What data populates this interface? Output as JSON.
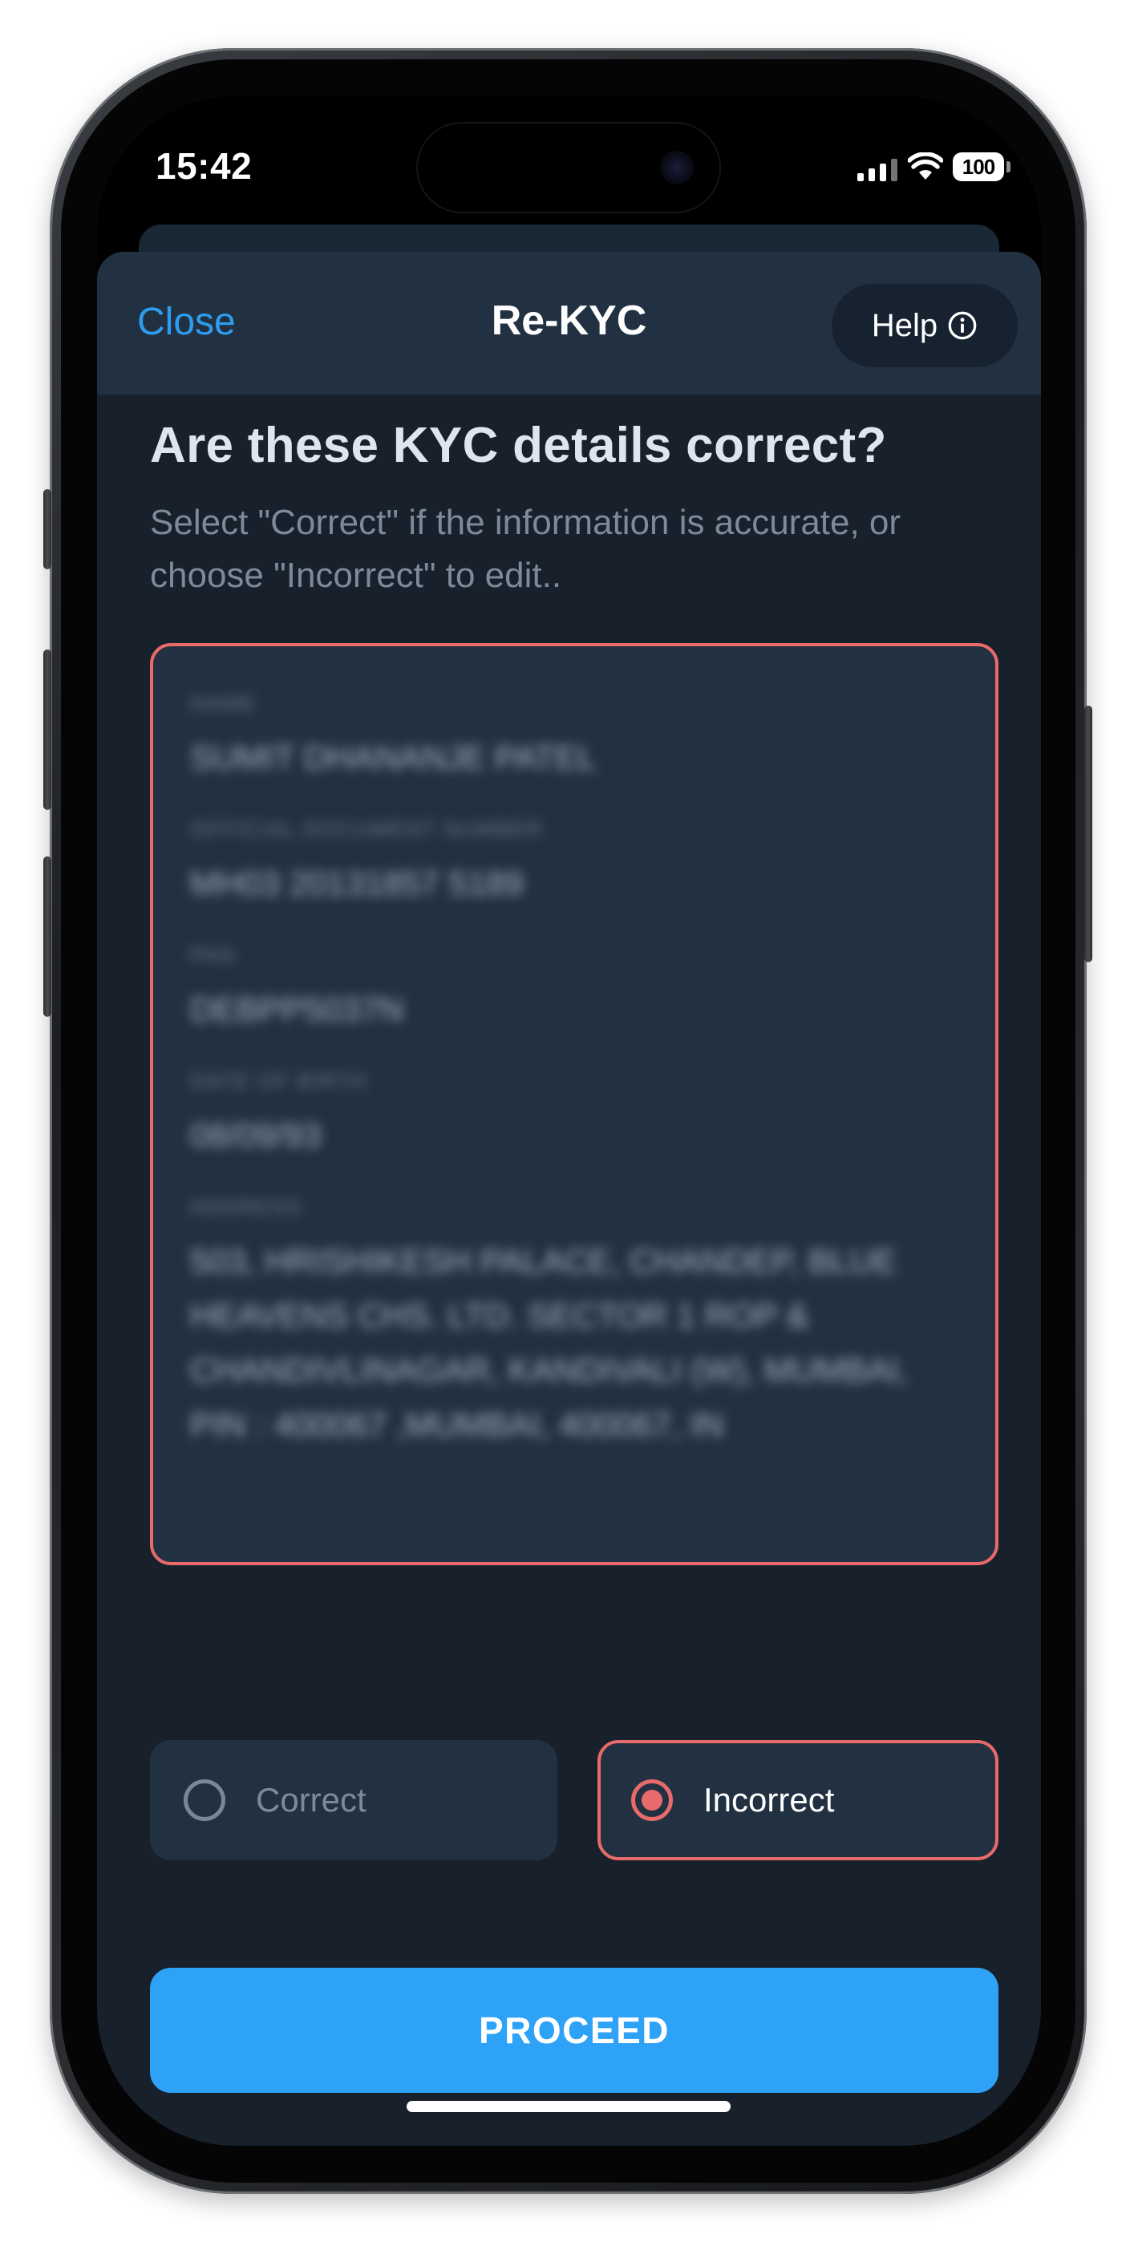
{
  "status_bar": {
    "time": "15:42",
    "battery": "100",
    "signal_bars": 4,
    "wifi_icon": "wifi-icon"
  },
  "header": {
    "close_label": "Close",
    "title": "Re-KYC",
    "help_label": "Help",
    "help_icon": "info-icon"
  },
  "content": {
    "title": "Are these KYC details correct?",
    "subtitle": "Select \"Correct\" if the information is accurate, or choose \"Incorrect\" to edit.."
  },
  "kyc_fields": [
    {
      "label": "Name",
      "value": "SUMIT DHANANJE PATEL"
    },
    {
      "label": "Official Document Number",
      "value": "MH03 20131857 5189"
    },
    {
      "label": "PAN",
      "value": "DEBPP5037N"
    },
    {
      "label": "Date of Birth",
      "value": "08/09/93"
    },
    {
      "label": "Address",
      "value": "503, HRISHIKESH PALACE, CHANDEP, BLUE HEAVENS CHS. LTD. SECTOR 1 ROP & CHANDIVLINAGAR, KANDIVALI (W), MUMBAI, PIN : 400067 ,MUMBAI, 400067, IN"
    }
  ],
  "options": {
    "correct_label": "Correct",
    "incorrect_label": "Incorrect",
    "selected": "Incorrect"
  },
  "proceed_label": "PROCEED",
  "colors": {
    "accent": "#2ea2f7",
    "error": "#e86a6a",
    "background": "#17202b",
    "card": "#223142"
  }
}
